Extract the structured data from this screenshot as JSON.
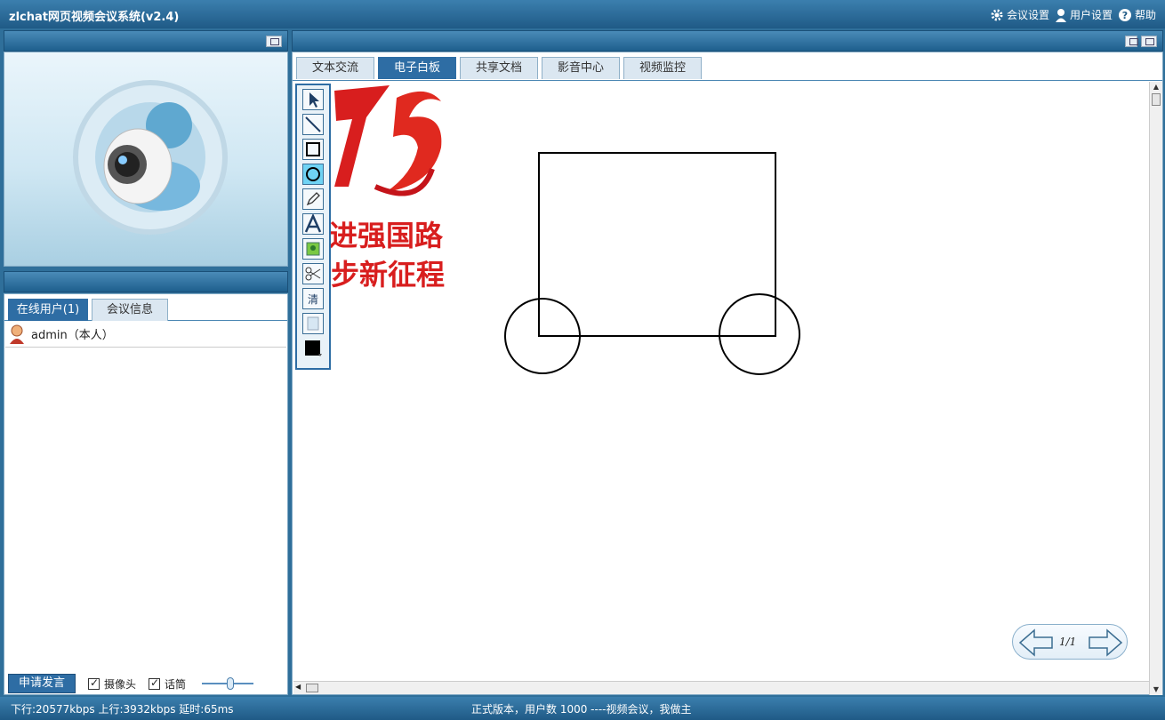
{
  "app": {
    "title": "zlchat网页视频会议系统(v2.4)"
  },
  "top_menu": [
    {
      "label": "会议设置",
      "icon": "gear-icon"
    },
    {
      "label": "用户设置",
      "icon": "user-icon"
    },
    {
      "label": "帮助",
      "icon": "help-icon"
    }
  ],
  "left_tabs": [
    {
      "label": "在线用户(1)",
      "active": true
    },
    {
      "label": "会议信息",
      "active": false
    }
  ],
  "users": [
    {
      "name": "admin（本人）"
    }
  ],
  "controls": {
    "apply_label": "申请发言",
    "camera_label": "摄像头",
    "mic_label": "话筒",
    "volume": 0.5
  },
  "main_tabs": [
    {
      "label": "文本交流",
      "active": false
    },
    {
      "label": "电子白板",
      "active": true
    },
    {
      "label": "共享文档",
      "active": false
    },
    {
      "label": "影音中心",
      "active": false
    },
    {
      "label": "视频监控",
      "active": false
    }
  ],
  "whiteboard": {
    "banner_lines": [
      "进强国路",
      "步新征程"
    ],
    "page": "1/1",
    "tools": [
      "select-tool",
      "line-tool",
      "rectangle-tool",
      "ellipse-tool",
      "pencil-tool",
      "text-tool",
      "image-tool",
      "cut-tool",
      "clear-tool",
      "blank-tool",
      "color-tool"
    ],
    "active_tool": "ellipse-tool",
    "pen_color": "#000000"
  },
  "status": {
    "left": "下行:20577kbps  上行:3932kbps  延时:65ms",
    "center": "正式版本，用户数 1000 ----视频会议，我做主"
  },
  "colors": {
    "accent": "#2e6da4",
    "banner_red": "#d81e1e"
  }
}
